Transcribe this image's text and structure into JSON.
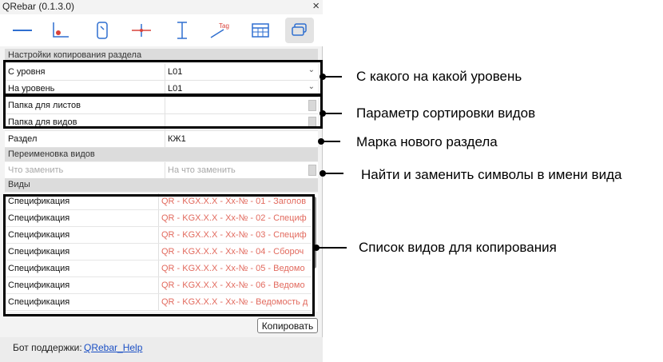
{
  "window": {
    "title": "QRebar (0.1.3.0)",
    "close_glyph": "×"
  },
  "toolbar": {
    "tools": [
      {
        "icon": "line-icon"
      },
      {
        "icon": "dimension-icon"
      },
      {
        "icon": "cursor-icon"
      },
      {
        "icon": "crosshair-icon"
      },
      {
        "icon": "text-i-icon"
      },
      {
        "icon": "tag-icon",
        "text": "Tag"
      },
      {
        "icon": "table-icon"
      },
      {
        "icon": "copy-views-icon",
        "active": true
      }
    ]
  },
  "section_copy": {
    "header": "Настройки копирования раздела",
    "from_level": {
      "label": "С уровня",
      "value": "L01"
    },
    "to_level": {
      "label": "На уровень",
      "value": "L01"
    },
    "sheets_folder": {
      "label": "Папка для листов",
      "value": ""
    },
    "views_folder": {
      "label": "Папка для видов",
      "value": ""
    },
    "section": {
      "label": "Раздел",
      "value": "КЖ1"
    }
  },
  "rename": {
    "header": "Переименовка видов",
    "find_placeholder": "Что заменить",
    "replace_placeholder": "На что заменить"
  },
  "views": {
    "header": "Виды",
    "rows": [
      {
        "type": "Спецификация",
        "name": "QR - KGX.X.X - Хх-№ - 01 - Заголов"
      },
      {
        "type": "Спецификация",
        "name": "QR - KGX.X.X - Хх-№ - 02 - Специф"
      },
      {
        "type": "Спецификация",
        "name": "QR - KGX.X.X - Хх-№ - 03 - Специф"
      },
      {
        "type": "Спецификация",
        "name": "QR - KGX.X.X - Хх-№ - 04 - Сбороч"
      },
      {
        "type": "Спецификация",
        "name": "QR - KGX.X.X - Хх-№ - 05 - Ведомо"
      },
      {
        "type": "Спецификация",
        "name": "QR - KGX.X.X - Хх-№ - 06 - Ведомо"
      },
      {
        "type": "Спецификация",
        "name": "QR - KGX.X.X - Хх-№ - Ведомость д"
      }
    ]
  },
  "copy_button": "Копировать",
  "footer": {
    "label": "Бот поддержки:",
    "link": "QRebar_Help"
  },
  "annotations": [
    "С какого на какой уровень",
    "Параметр сортировки видов",
    "Марка нового раздела",
    "Найти и заменить символы в имени вида",
    "Список видов для копирования"
  ],
  "colors": {
    "view_name": "#e26a5e",
    "link": "#1a4fc4",
    "accent_red": "#d9423a",
    "accent_blue": "#2f6fd0"
  }
}
